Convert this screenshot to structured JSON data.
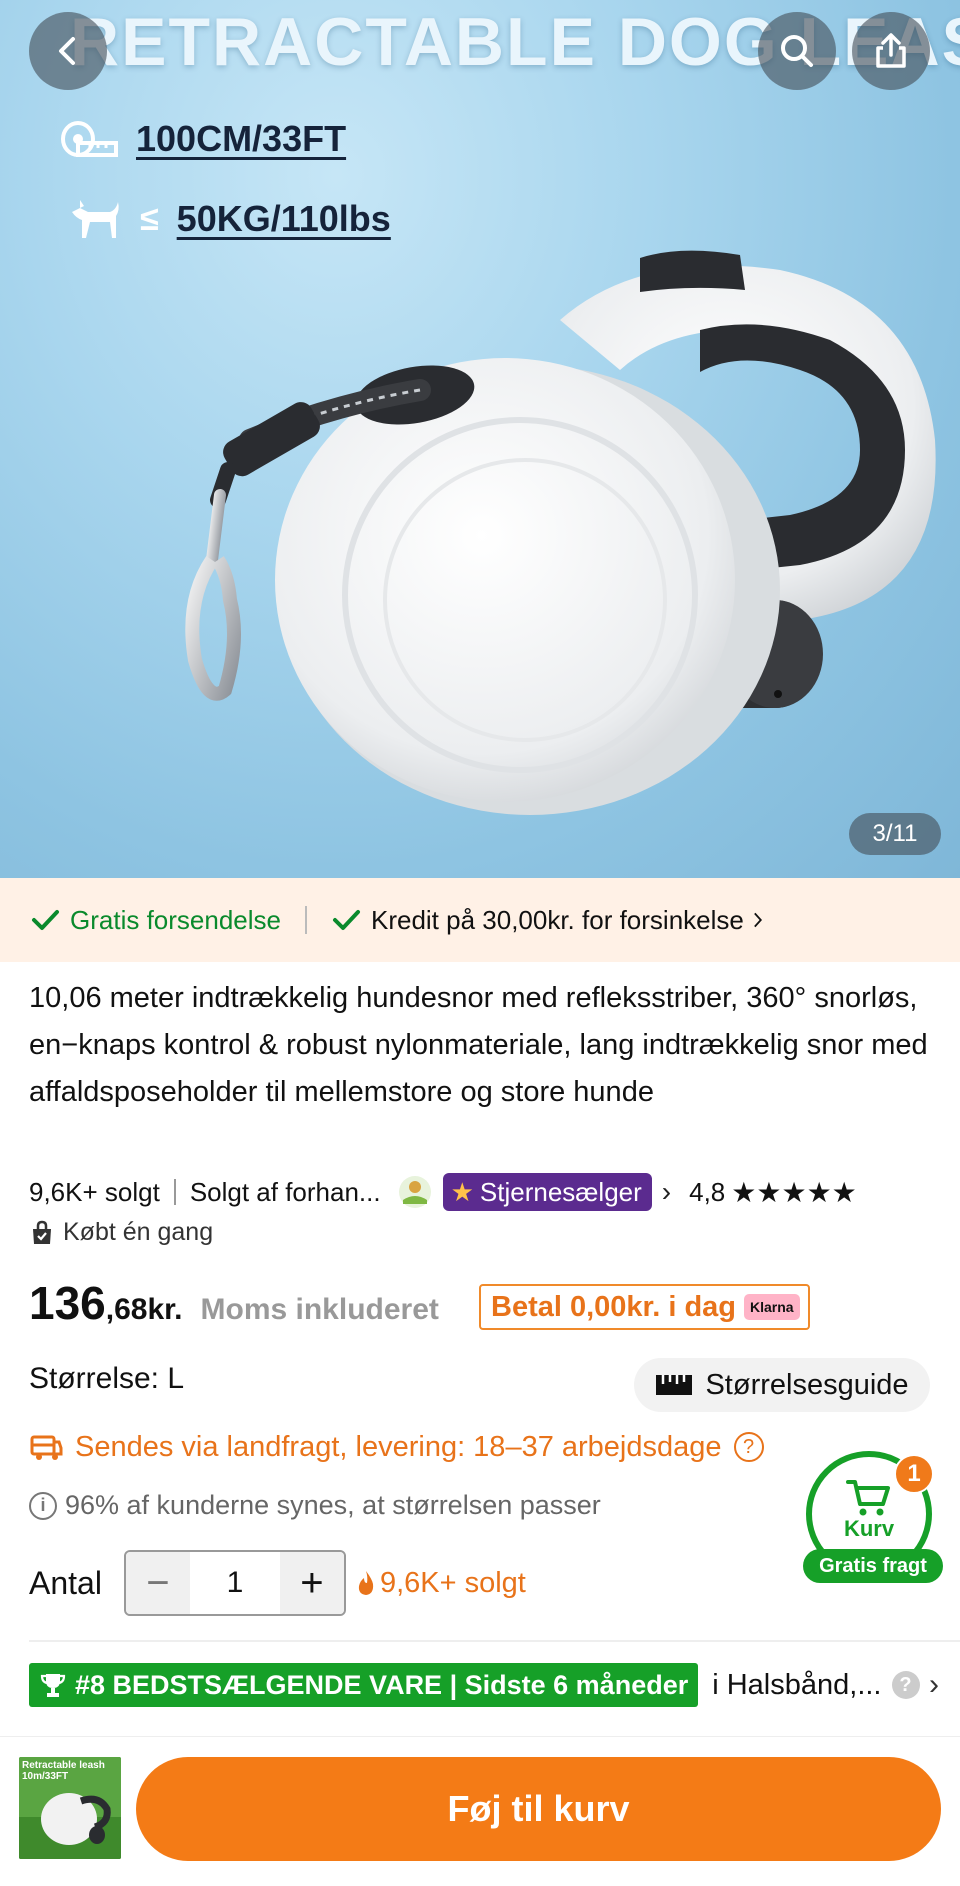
{
  "hero": {
    "title": "RETRACTABLE DOG LEASH",
    "spec_length": "100CM/33FT",
    "spec_le": "≤",
    "spec_weight": "50KG/110lbs",
    "image_counter": "3/11"
  },
  "benefits": {
    "free_shipping": "Gratis forsendelse",
    "delay_credit": "Kredit på 30,00kr. for forsinkelse"
  },
  "product": {
    "title": "10,06 meter indtrækkelig hundesnor med refleksstriber, 360° snorløs, en−knaps kontrol & robust nylonmateriale, lang indtrækkelig snor med affaldsposeholder til mellemstore og store hunde",
    "sold": "9,6K+ solgt",
    "seller": "Solgt af forhan...",
    "star_seller": "Stjernesælger",
    "rating": "4,8",
    "stars": "★★★★★",
    "bought": "Købt én gang"
  },
  "price": {
    "integer": "136",
    "decimal": ",68kr.",
    "vat": "Moms inkluderet",
    "pay_today": "Betal 0,00kr. i dag",
    "klarna": "Klarna"
  },
  "size": {
    "label": "Størrelse: L",
    "guide": "Størrelsesguide"
  },
  "shipping": {
    "text": "Sendes via landfragt, levering: 18–37 arbejdsdage",
    "help": "?"
  },
  "fit": {
    "text": "96% af kunderne synes, at størrelsen passer",
    "info": "i"
  },
  "quantity": {
    "label": "Antal",
    "minus": "−",
    "value": "1",
    "plus": "+",
    "sold": "9,6K+ solgt"
  },
  "cart": {
    "label": "Kurv",
    "count": "1",
    "free_shipping": "Gratis fragt"
  },
  "ranking": {
    "badge": "#8 BEDSTSÆLGENDE VARE | Sidste 6 måneder",
    "category": "i Halsbånd,...",
    "help": "?"
  },
  "bottom": {
    "thumb_text": "Retractable leash 10m/33FT",
    "add_to_cart": "Føj til kurv"
  },
  "colors": {
    "accent_orange": "#f47b16",
    "green": "#16a028",
    "star_seller_purple": "#5b2b8f"
  },
  "icons": [
    "back-icon",
    "search-icon",
    "share-icon",
    "check-icon",
    "chevron-right-icon",
    "bag-icon",
    "ruler-icon",
    "truck-icon",
    "help-icon",
    "info-icon",
    "fire-icon",
    "cart-icon",
    "trophy-icon",
    "tape-measure-icon",
    "dog-icon"
  ]
}
